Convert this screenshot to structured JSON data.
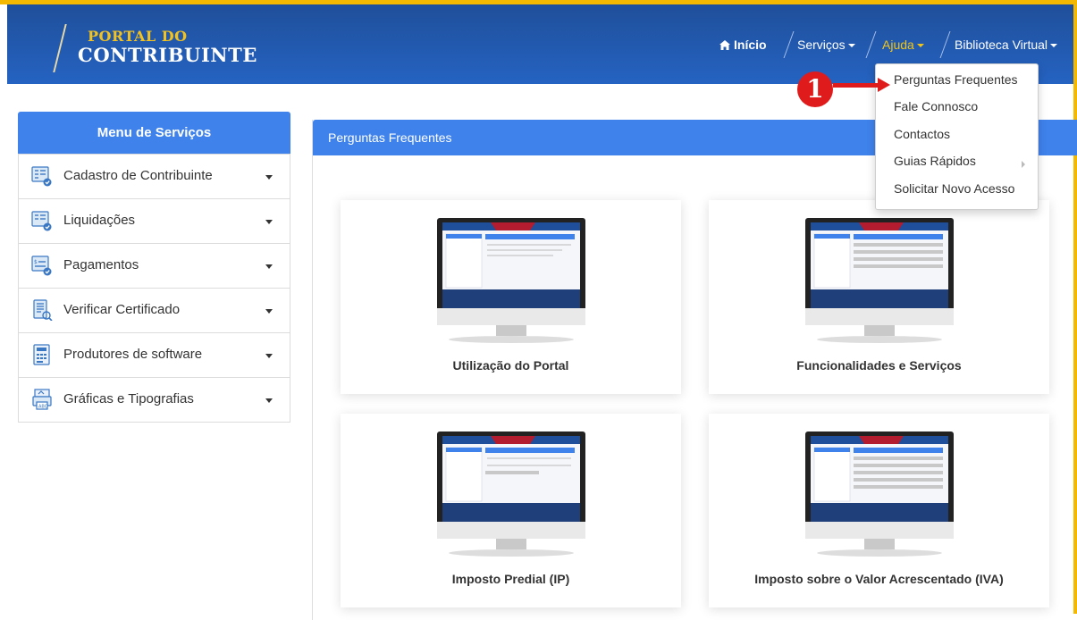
{
  "header": {
    "logo_line1": "PORTAL DO",
    "logo_line2": "CONTRIBUINTE",
    "nav": [
      {
        "label": "Início",
        "icon": "home-icon"
      },
      {
        "label": "Serviços"
      },
      {
        "label": "Ajuda"
      },
      {
        "label": "Biblioteca Virtual"
      }
    ]
  },
  "dropdown": {
    "items": [
      {
        "label": "Perguntas Frequentes"
      },
      {
        "label": "Fale Connosco"
      },
      {
        "label": "Contactos"
      },
      {
        "label": "Guias Rápidos"
      },
      {
        "label": "Solicitar Novo Acesso"
      }
    ]
  },
  "annotation": {
    "number": "1"
  },
  "sidebar": {
    "title": "Menu de Serviços",
    "items": [
      {
        "label": "Cadastro de Contribuinte",
        "icon": "form-icon"
      },
      {
        "label": "Liquidações",
        "icon": "form-icon"
      },
      {
        "label": "Pagamentos",
        "icon": "form-icon"
      },
      {
        "label": "Verificar Certificado",
        "icon": "certificate-icon"
      },
      {
        "label": "Produtores de software",
        "icon": "calculator-icon"
      },
      {
        "label": "Gráficas e Tipografias",
        "icon": "printer-icon"
      }
    ]
  },
  "main": {
    "title": "Perguntas Frequentes",
    "cards": [
      {
        "label": "Utilização do Portal"
      },
      {
        "label": "Funcionalidades e Serviços"
      },
      {
        "label": "Imposto Predial (IP)"
      },
      {
        "label": "Imposto sobre o Valor Acrescentado (IVA)"
      }
    ]
  },
  "colors": {
    "accent": "#3f82ec",
    "header": "#1f4f9a",
    "frame": "#f5b800",
    "active_nav": "#f0c419",
    "annotation": "#e01b1b"
  }
}
